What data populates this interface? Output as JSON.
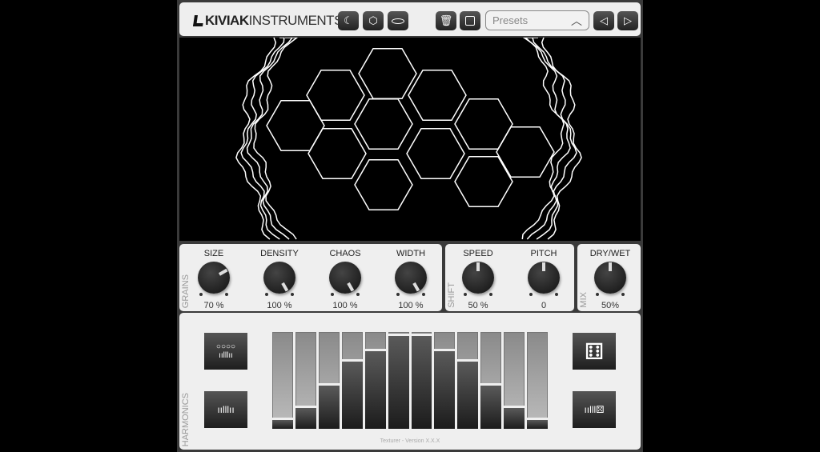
{
  "header": {
    "logo_bold": "KIVIAK",
    "logo_light": "INSTRUMENTS",
    "presets_placeholder": "Presets",
    "buttons": [
      "moon-icon",
      "settings-icon",
      "cloud-icon",
      "trash-icon",
      "save-icon",
      "prev-icon",
      "next-icon"
    ]
  },
  "panels": [
    {
      "label": "GRAINS",
      "knobs": [
        {
          "name": "SIZE",
          "value": "70 %",
          "level": 0.7
        },
        {
          "name": "DENSITY",
          "value": "100 %",
          "level": 1.0
        },
        {
          "name": "CHAOS",
          "value": "100 %",
          "level": 1.0
        },
        {
          "name": "WIDTH",
          "value": "100 %",
          "level": 1.0
        }
      ]
    },
    {
      "label": "SHIFT",
      "knobs": [
        {
          "name": "SPEED",
          "value": "50 %",
          "level": 0.5
        },
        {
          "name": "PITCH",
          "value": "0",
          "level": 0.5
        }
      ]
    },
    {
      "label": "MIX",
      "knobs": [
        {
          "name": "DRY/WET",
          "value": "50%",
          "level": 0.5
        }
      ]
    }
  ],
  "harmonics": {
    "label": "HARMONICS",
    "levels": [
      0.12,
      0.24,
      0.48,
      0.73,
      0.84,
      1.0,
      1.0,
      0.84,
      0.73,
      0.48,
      0.24,
      0.12
    ],
    "version": "Texturer - Version X.X.X"
  }
}
